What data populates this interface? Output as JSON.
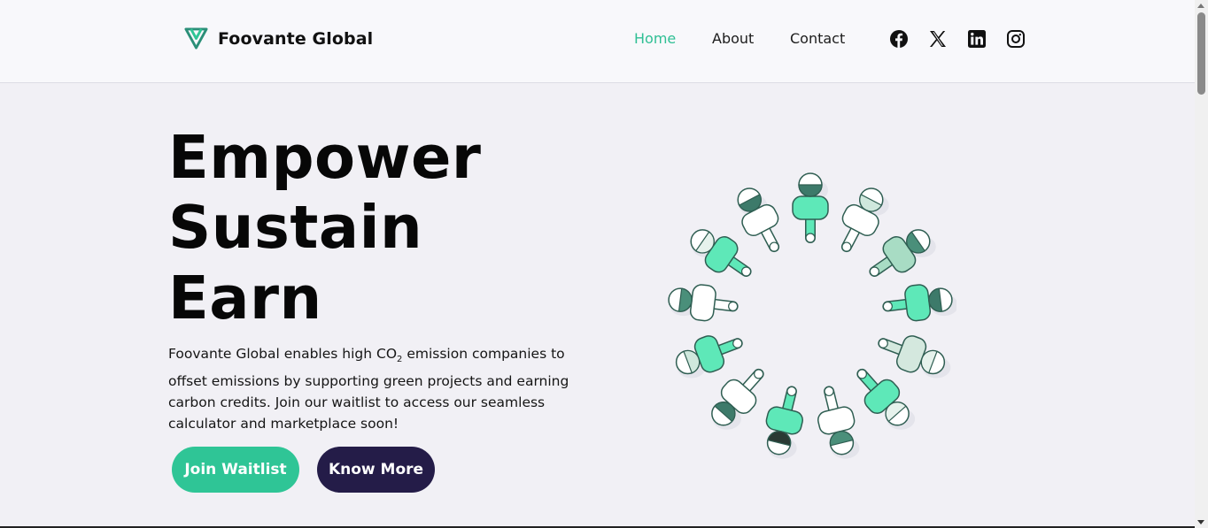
{
  "header": {
    "brand_name": "Foovante Global",
    "nav": [
      {
        "label": "Home",
        "active": true
      },
      {
        "label": "About",
        "active": false
      },
      {
        "label": "Contact",
        "active": false
      }
    ],
    "social_icons": [
      "facebook-icon",
      "x-icon",
      "linkedin-icon",
      "instagram-icon"
    ]
  },
  "hero": {
    "headline_lines": [
      "Empower",
      "Sustain",
      "Earn"
    ],
    "description_before": "Foovante Global enables high CO",
    "description_sub": "2",
    "description_after": " emission companies to offset emissions by supporting green projects and earning carbon credits. Join our waitlist to access our seamless calculator and marketplace soon!",
    "join_button": "Join Waitlist",
    "more_button": "Know More"
  },
  "colors": {
    "accent_green": "#2fc596",
    "dark_navy": "#241c48",
    "background": "#f1f0f5",
    "header_bg": "#f8f8fb"
  }
}
